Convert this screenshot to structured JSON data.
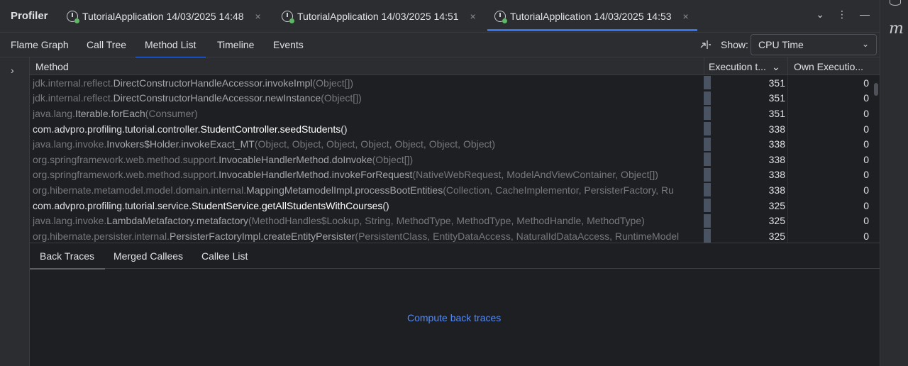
{
  "header": {
    "title": "Profiler",
    "tabs": [
      {
        "label": "TutorialApplication 14/03/2025 14:48",
        "close": "×"
      },
      {
        "label": "TutorialApplication 14/03/2025 14:51",
        "close": "×"
      },
      {
        "label": "TutorialApplication 14/03/2025 14:53",
        "close": "×"
      }
    ],
    "icons": {
      "dropdown": "⌄",
      "more": "⋮",
      "minimize": "—"
    }
  },
  "view_tabs": [
    "Flame Graph",
    "Call Tree",
    "Method List",
    "Timeline",
    "Events"
  ],
  "show": {
    "label": "Show:",
    "value": "CPU Time",
    "chevron": "⌄"
  },
  "table": {
    "columns": {
      "method": "Method",
      "exec": "Execution t...",
      "exec_chev": "⌄",
      "own": "Own Executio..."
    },
    "rows": [
      {
        "pkg": "jdk.internal.reflect.",
        "name": "DirectConstructorHandleAccessor.invokeImpl",
        "args": "(Object[])",
        "exec": "351",
        "own": "0",
        "hl": false
      },
      {
        "pkg": "jdk.internal.reflect.",
        "name": "DirectConstructorHandleAccessor.newInstance",
        "args": "(Object[])",
        "exec": "351",
        "own": "0",
        "hl": false
      },
      {
        "pkg": "java.lang.",
        "name": "Iterable.forEach",
        "args": "(Consumer)",
        "exec": "351",
        "own": "0",
        "hl": false
      },
      {
        "pkg": "com.advpro.profiling.tutorial.controller.",
        "name": "StudentController.seedStudents",
        "args": "()",
        "exec": "338",
        "own": "0",
        "hl": true
      },
      {
        "pkg": "java.lang.invoke.",
        "name": "Invokers$Holder.invokeExact_MT",
        "args": "(Object, Object, Object, Object, Object, Object, Object)",
        "exec": "338",
        "own": "0",
        "hl": false
      },
      {
        "pkg": "org.springframework.web.method.support.",
        "name": "InvocableHandlerMethod.doInvoke",
        "args": "(Object[])",
        "exec": "338",
        "own": "0",
        "hl": false
      },
      {
        "pkg": "org.springframework.web.method.support.",
        "name": "InvocableHandlerMethod.invokeForRequest",
        "args": "(NativeWebRequest, ModelAndViewContainer, Object[])",
        "exec": "338",
        "own": "0",
        "hl": false
      },
      {
        "pkg": "org.hibernate.metamodel.model.domain.internal.",
        "name": "MappingMetamodelImpl.processBootEntities",
        "args": "(Collection, CacheImplementor, PersisterFactory, Ru",
        "exec": "338",
        "own": "0",
        "hl": false
      },
      {
        "pkg": "com.advpro.profiling.tutorial.service.",
        "name": "StudentService.getAllStudentsWithCourses",
        "args": "()",
        "exec": "325",
        "own": "0",
        "hl": true
      },
      {
        "pkg": "java.lang.invoke.",
        "name": "LambdaMetafactory.metafactory",
        "args": "(MethodHandles$Lookup, String, MethodType, MethodType, MethodHandle, MethodType)",
        "exec": "325",
        "own": "0",
        "hl": false
      },
      {
        "pkg": "org.hibernate.persister.internal.",
        "name": "PersisterFactoryImpl.createEntityPersister",
        "args": "(PersistentClass, EntityDataAccess, NaturalIdDataAccess, RuntimeModel",
        "exec": "325",
        "own": "0",
        "hl": false
      }
    ]
  },
  "bottom": {
    "tabs": [
      "Back Traces",
      "Merged Callees",
      "Callee List"
    ],
    "link": "Compute back traces"
  },
  "side": {
    "expand_arrow": "›",
    "right_icon": "m"
  }
}
